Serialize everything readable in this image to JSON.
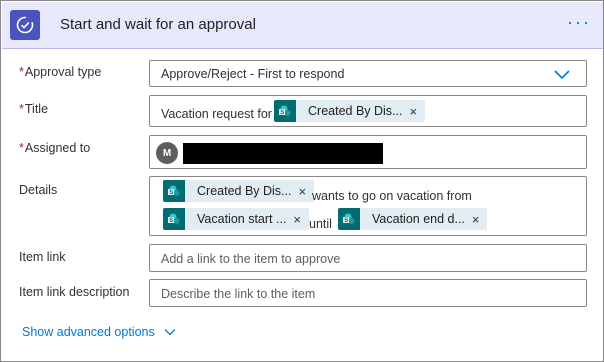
{
  "header": {
    "title": "Start and wait for an approval",
    "more": "···",
    "icon": "approval-check-icon"
  },
  "approval_type": {
    "label": "Approval type",
    "required": "*",
    "value": "Approve/Reject - First to respond"
  },
  "title_field": {
    "label": "Title",
    "required": "*",
    "prefix": "Vacation request for",
    "token": "Created By Dis..."
  },
  "assigned_to": {
    "label": "Assigned to",
    "required": "*",
    "avatar_initial": "M"
  },
  "details": {
    "label": "Details",
    "token1": "Created By Dis...",
    "text1": "wants to go on vacation from",
    "token2": "Vacation start ...",
    "text2": "until",
    "token3": "Vacation end d..."
  },
  "item_link": {
    "label": "Item link",
    "placeholder": "Add a link to the item to approve"
  },
  "item_link_description": {
    "label": "Item link description",
    "placeholder": "Describe the link to the item"
  },
  "advanced": {
    "label": "Show advanced options"
  },
  "token_close": "×",
  "colors": {
    "accent": "#0078d4",
    "header_bg": "#e8e8fc",
    "icon_bg": "#4b53bc",
    "token_bg": "#e1ecf3",
    "sharepoint": "#036c70",
    "required": "#a4262c"
  }
}
